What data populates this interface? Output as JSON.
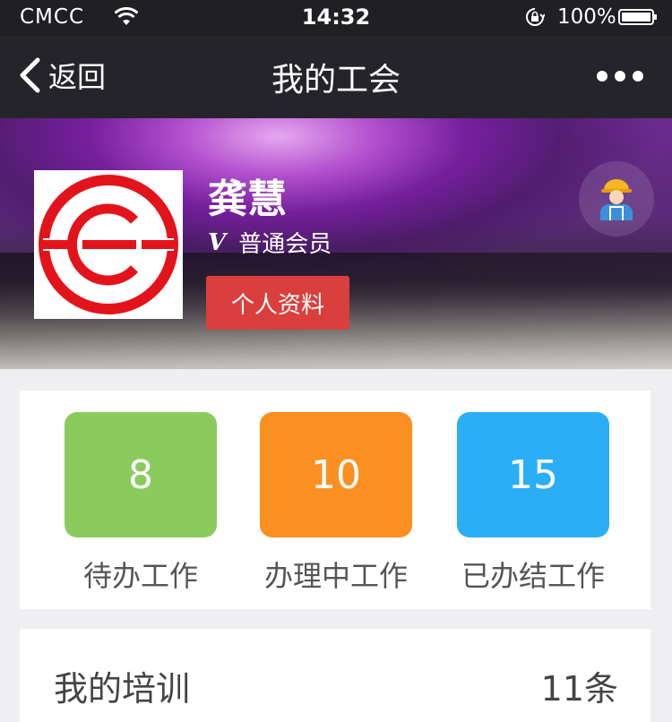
{
  "status_bar": {
    "carrier": "CMCC",
    "time": "14:32",
    "battery": "100%",
    "icons": [
      "wifi-icon",
      "orientation-lock-icon",
      "battery-icon"
    ]
  },
  "nav": {
    "back_label": "返回",
    "title": "我的工会",
    "icons": [
      "chevron-left-icon",
      "more-icon"
    ]
  },
  "profile": {
    "name": "龚慧",
    "level_prefix": "V",
    "level": "普通会员",
    "profile_button": "个人资料",
    "icons": [
      "union-logo",
      "worker-avatar-icon"
    ]
  },
  "work": {
    "items": [
      {
        "count": "8",
        "label": "待办工作",
        "color": "#8bcb5d"
      },
      {
        "count": "10",
        "label": "办理中工作",
        "color": "#fb8f22"
      },
      {
        "count": "15",
        "label": "已办结工作",
        "color": "#2aaef5"
      }
    ]
  },
  "training": {
    "title": "我的培训",
    "count": "11条"
  },
  "colors": {
    "profile_button": "#d9403d",
    "nav_background": "#26242b",
    "page_background": "#efeff1"
  }
}
